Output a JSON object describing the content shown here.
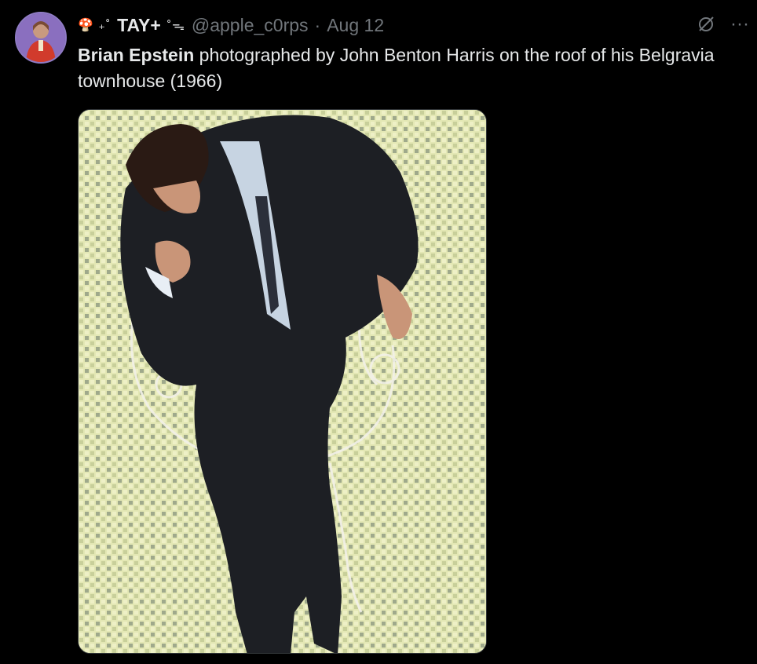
{
  "tweet": {
    "author": {
      "name_prefix": "🍄 ₊˚",
      "display_name": "TAY+",
      "name_suffix": "˚ᯓ",
      "handle": "@apple_c0rps",
      "separator": "·",
      "date": "Aug 12"
    },
    "text": {
      "bold": "Brian Epstein",
      "rest": " photographed by John Benton Harris on the roof of his Belgravia townhouse (1966)"
    },
    "icons": {
      "avatar": "avatar",
      "grok": "grok-icon",
      "more": "more-icon",
      "photo": "photo"
    },
    "colors": {
      "background": "#000000",
      "text": "#e7e9ea",
      "secondary": "#71767b"
    },
    "more_label": "···"
  }
}
